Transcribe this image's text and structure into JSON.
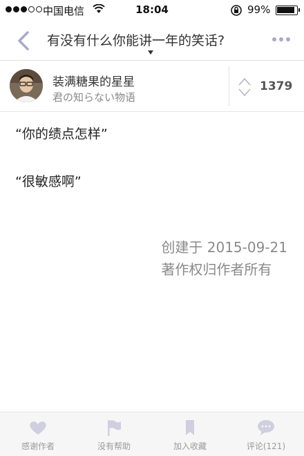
{
  "status_bar": {
    "carrier": "中国电信",
    "time": "18:04",
    "battery": "99%"
  },
  "nav": {
    "title": "有没有什么你能讲一年的笑话?"
  },
  "answer": {
    "author_name": "装满糖果的星星",
    "author_bio": "君の知らない物语",
    "vote_count": "1379",
    "paragraphs": [
      "“你的绩点怎样”",
      "“很敏感啊”"
    ],
    "created": "创建于 2015-09-21",
    "copyright": "著作权归作者所有"
  },
  "tab_bar": {
    "items": [
      {
        "label": "感谢作者",
        "icon": "heart-icon"
      },
      {
        "label": "没有帮助",
        "icon": "flag-icon"
      },
      {
        "label": "加入收藏",
        "icon": "bookmark-icon"
      },
      {
        "label": "评论(121)",
        "icon": "comment-icon"
      }
    ]
  },
  "colors": {
    "accent": "#a9a9c8",
    "tab_icon": "#cfcfe0",
    "meta_text": "#8a8a8a"
  }
}
